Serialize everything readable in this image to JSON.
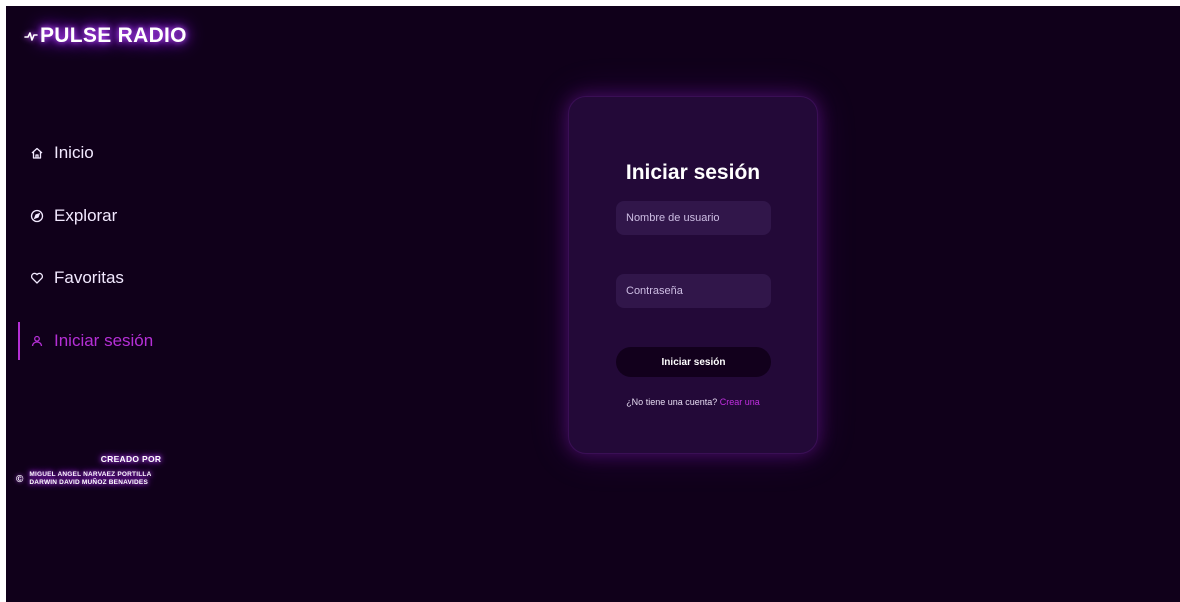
{
  "brand": {
    "name": "PULSE RADIO",
    "icon": "pulse-icon"
  },
  "sidebar": {
    "items": [
      {
        "label": "Inicio",
        "icon": "home-icon"
      },
      {
        "label": "Explorar",
        "icon": "compass-icon"
      },
      {
        "label": "Favoritas",
        "icon": "heart-icon"
      },
      {
        "label": "Iniciar sesión",
        "icon": "user-icon",
        "active": true
      }
    ]
  },
  "credits": {
    "title": "CREADO POR",
    "copyright_symbol": "©",
    "authors": [
      "MIGUEL ANGEL NARVAEZ PORTILLA",
      "DARWIN DAVID MUÑOZ BENAVIDES"
    ]
  },
  "login": {
    "title": "Iniciar sesión",
    "username_placeholder": "Nombre de usuario",
    "password_placeholder": "Contraseña",
    "submit_label": "Iniciar sesión",
    "signup_prompt": "¿No tiene una cuenta?",
    "signup_link": "Crear una"
  },
  "colors": {
    "background": "#10001a",
    "card": "#230938",
    "accent": "#b52fd6",
    "glow": "#9b2bff"
  }
}
